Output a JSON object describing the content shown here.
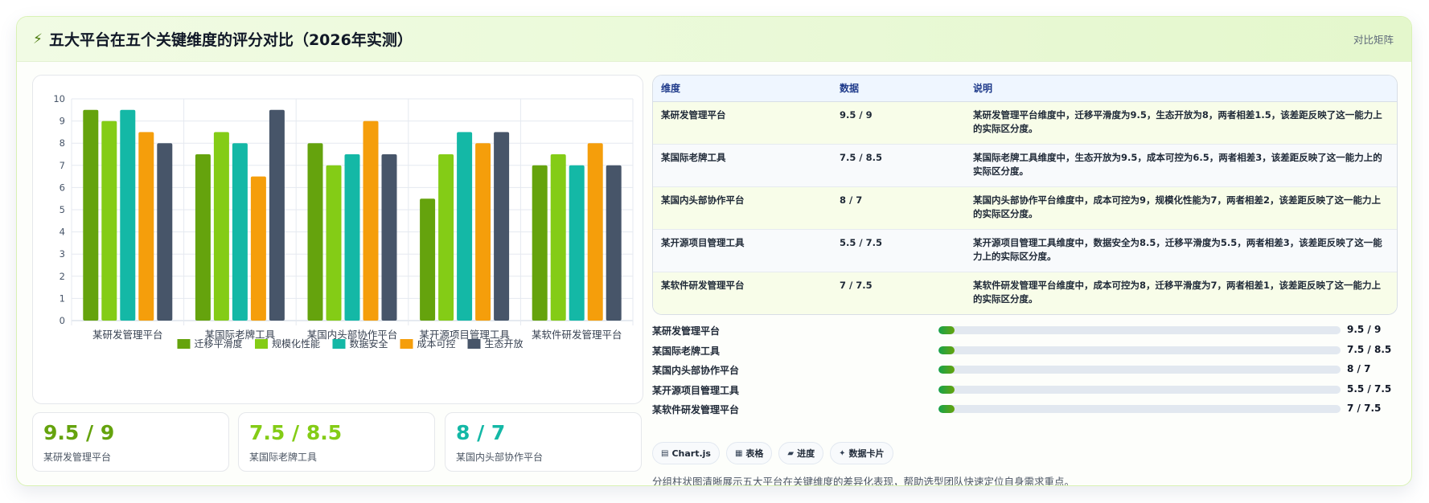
{
  "header": {
    "icon": "bolt-icon",
    "title": "五大平台在五个关键维度的评分对比（2026年实测）",
    "tag": "对比矩阵"
  },
  "colors": {
    "series": [
      "#65a30d",
      "#84cc16",
      "#14b8a6",
      "#f59e0b",
      "#475569"
    ],
    "kpi": [
      "#65a30d",
      "#84cc16",
      "#14b8a6"
    ]
  },
  "chart_data": {
    "type": "bar",
    "categories": [
      "某研发管理平台",
      "某国际老牌工具",
      "某国内头部协作平台",
      "某开源项目管理工具",
      "某软件研发管理平台"
    ],
    "series": [
      {
        "name": "迁移平滑度",
        "values": [
          9.5,
          7.5,
          8,
          5.5,
          7
        ]
      },
      {
        "name": "规模化性能",
        "values": [
          9,
          8.5,
          7,
          7.5,
          7.5
        ]
      },
      {
        "name": "数据安全",
        "values": [
          9.5,
          8,
          7.5,
          8.5,
          7
        ]
      },
      {
        "name": "成本可控",
        "values": [
          8.5,
          6.5,
          9,
          8,
          8
        ]
      },
      {
        "name": "生态开放",
        "values": [
          8,
          9.5,
          7.5,
          8.5,
          7
        ]
      }
    ],
    "ylim": [
      0,
      10
    ],
    "yticks": [
      "0",
      "1",
      "2",
      "3",
      "4",
      "5",
      "6",
      "7",
      "8",
      "9",
      "10"
    ],
    "grid": true,
    "legend": "bottom"
  },
  "kpis": [
    {
      "value": "9.5 / 9",
      "label": "某研发管理平台"
    },
    {
      "value": "7.5 / 8.5",
      "label": "某国际老牌工具"
    },
    {
      "value": "8 / 7",
      "label": "某国内头部协作平台"
    }
  ],
  "table": {
    "headers": [
      "维度",
      "数据",
      "说明"
    ],
    "rows": [
      {
        "name": "某研发管理平台",
        "data": "9.5 / 9",
        "desc": "某研发管理平台维度中，迁移平滑度为9.5，生态开放为8，两者相差1.5，该差距反映了这一能力上的实际区分度。"
      },
      {
        "name": "某国际老牌工具",
        "data": "7.5 / 8.5",
        "desc": "某国际老牌工具维度中，生态开放为9.5，成本可控为6.5，两者相差3，该差距反映了这一能力上的实际区分度。"
      },
      {
        "name": "某国内头部协作平台",
        "data": "8 / 7",
        "desc": "某国内头部协作平台维度中，成本可控为9，规模化性能为7，两者相差2，该差距反映了这一能力上的实际区分度。"
      },
      {
        "name": "某开源项目管理工具",
        "data": "5.5 / 7.5",
        "desc": "某开源项目管理工具维度中，数据安全为8.5，迁移平滑度为5.5，两者相差3，该差距反映了这一能力上的实际区分度。"
      },
      {
        "name": "某软件研发管理平台",
        "data": "7 / 7.5",
        "desc": "某软件研发管理平台维度中，成本可控为8，迁移平滑度为7，两者相差1，该差距反映了这一能力上的实际区分度。"
      }
    ]
  },
  "progress": [
    {
      "name": "某研发管理平台",
      "value": "9.5 / 9",
      "fill_fraction": 0.04
    },
    {
      "name": "某国际老牌工具",
      "value": "7.5 / 8.5",
      "fill_fraction": 0.04
    },
    {
      "name": "某国内头部协作平台",
      "value": "8 / 7",
      "fill_fraction": 0.04
    },
    {
      "name": "某开源项目管理工具",
      "value": "5.5 / 7.5",
      "fill_fraction": 0.04
    },
    {
      "name": "某软件研发管理平台",
      "value": "7 / 7.5",
      "fill_fraction": 0.04
    }
  ],
  "chips": [
    {
      "icon": "chart-icon",
      "glyph": "▤",
      "label": "Chart.js"
    },
    {
      "icon": "table-icon",
      "glyph": "▦",
      "label": "表格"
    },
    {
      "icon": "progress-icon",
      "glyph": "▰",
      "label": "进度"
    },
    {
      "icon": "sparkle-icon",
      "glyph": "✦",
      "label": "数据卡片"
    }
  ],
  "note": "分组柱状图清晰展示五大平台在关键维度的差异化表现，帮助选型团队快速定位自身需求重点。"
}
